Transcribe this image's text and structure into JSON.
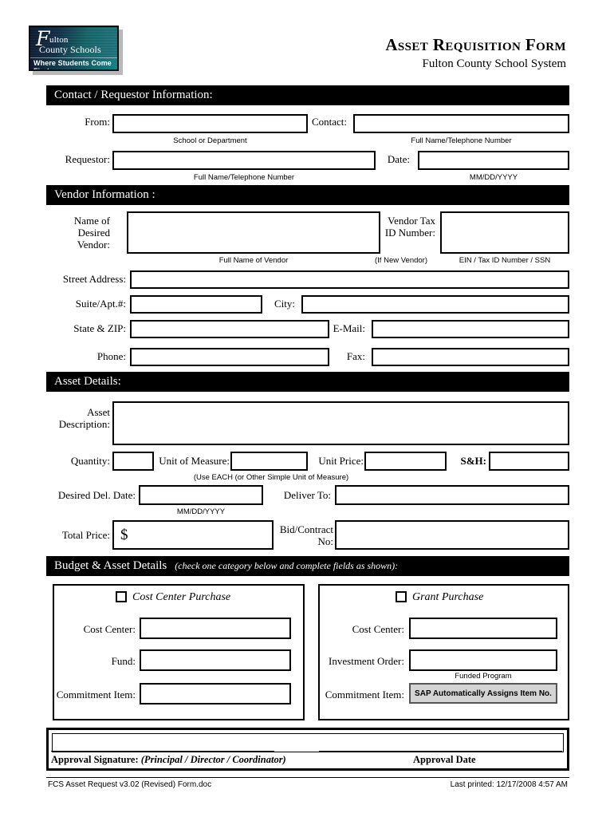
{
  "header": {
    "logo": {
      "script_letter": "F",
      "line1": "ulton",
      "line2": "County Schools",
      "tagline": "Where Students Come First"
    },
    "title": "Asset Requisition Form",
    "subtitle": "Fulton County School System"
  },
  "sections": {
    "contact": {
      "bar_title": "Contact / Requestor Information:",
      "from_label": "From:",
      "from_hint": "School or Department",
      "contact_label": "Contact:",
      "contact_hint": "Full Name/Telephone Number",
      "requestor_label": "Requestor:",
      "requestor_hint": "Full Name/Telephone Number",
      "date_label": "Date:",
      "date_hint": "MM/DD/YYYY"
    },
    "vendor": {
      "bar_title": "Vendor Information :",
      "name_label": "Name of\nDesired\nVendor:",
      "name_hint": "Full Name of Vendor",
      "tax_label": "Vendor Tax\nID Number:",
      "tax_note": "(If New Vendor)",
      "tax_hint": "EIN / Tax ID Number / SSN",
      "street_label": "Street Address:",
      "suite_label": "Suite/Apt.#:",
      "city_label": "City:",
      "state_label": "State & ZIP:",
      "email_label": "E-Mail:",
      "phone_label": "Phone:",
      "fax_label": "Fax:"
    },
    "asset": {
      "bar_title": "Asset Details:",
      "description_label": "Asset\nDescription:",
      "quantity_label": "Quantity:",
      "unit_measure_label": "Unit of Measure:",
      "unit_measure_hint": "(Use EACH (or Other Simple Unit of Measure)",
      "unit_price_label": "Unit Price:",
      "sh_label": "S&H:",
      "desired_date_label": "Desired Del. Date:",
      "desired_date_hint": "MM/DD/YYYY",
      "deliver_to_label": "Deliver To:",
      "total_price_label": "Total Price:",
      "total_price_prefix": "$",
      "bid_label": "Bid/Contract\nNo:"
    },
    "budget": {
      "bar_title": "Budget & Asset Details",
      "bar_note": "(check one category below and complete fields as shown):",
      "cost_center_panel": {
        "checkbox_label": "Cost Center Purchase",
        "field1_label": "Cost Center:",
        "field2_label": "Fund:",
        "field3_label": "Commitment Item:"
      },
      "grant_panel": {
        "checkbox_label": "Grant Purchase",
        "field1_label": "Cost Center:",
        "field2_label": "Investment Order:",
        "field2_hint": "Funded Program",
        "field3_label": "Commitment Item:",
        "field3_value": "SAP Automatically Assigns Item No."
      }
    },
    "approval": {
      "signature_label": "Approval Signature:",
      "signature_roles": "(Principal / Director / Coordinator)",
      "date_label": "Approval Date"
    }
  },
  "footer": {
    "left": "FCS Asset Request v3.02 (Revised) Form.doc",
    "right": "Last printed:  12/17/2008  4:57 AM"
  }
}
